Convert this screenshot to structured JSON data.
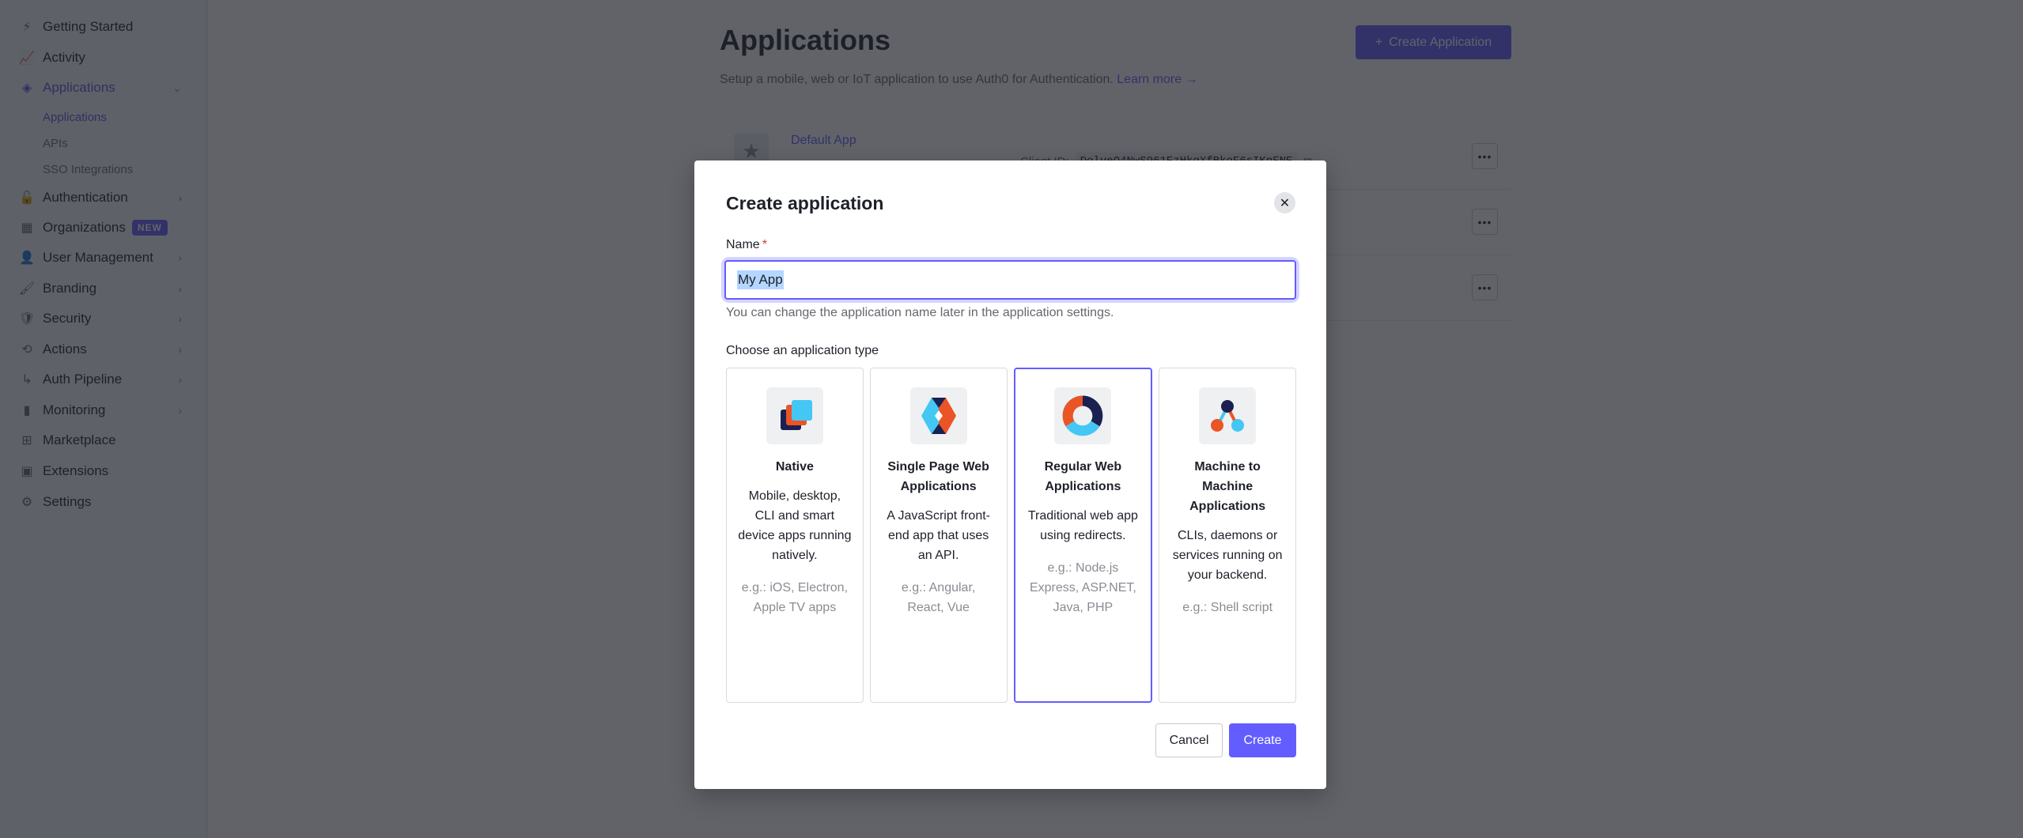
{
  "sidebar": {
    "items": [
      {
        "label": "Getting Started",
        "icon": "lightning-icon"
      },
      {
        "label": "Activity",
        "icon": "activity-icon"
      },
      {
        "label": "Applications",
        "icon": "layers-icon",
        "expanded": true,
        "active": true
      },
      {
        "label": "Authentication",
        "icon": "lock-icon"
      },
      {
        "label": "Organizations",
        "icon": "building-icon",
        "badge": "NEW"
      },
      {
        "label": "User Management",
        "icon": "users-icon"
      },
      {
        "label": "Branding",
        "icon": "brush-icon"
      },
      {
        "label": "Security",
        "icon": "shield-icon"
      },
      {
        "label": "Actions",
        "icon": "actions-icon"
      },
      {
        "label": "Auth Pipeline",
        "icon": "pipeline-icon"
      },
      {
        "label": "Monitoring",
        "icon": "chart-icon"
      },
      {
        "label": "Marketplace",
        "icon": "marketplace-icon"
      },
      {
        "label": "Extensions",
        "icon": "chip-icon"
      },
      {
        "label": "Settings",
        "icon": "gear-icon"
      }
    ],
    "subitems": [
      {
        "label": "Applications",
        "active": true
      },
      {
        "label": "APIs"
      },
      {
        "label": "SSO Integrations"
      }
    ]
  },
  "page": {
    "title": "Applications",
    "description": "Setup a mobile, web or IoT application to use Auth0 for Authentication.",
    "learn_more": "Learn more →",
    "create_button": "Create Application",
    "create_button_icon": "+",
    "apps": [
      {
        "name": "Default App",
        "client_id_label": "Client ID:",
        "client_id": "DolveQ4NwS961EzHkqXfBkoF6sIKnENE"
      }
    ],
    "more_label": "•••"
  },
  "modal": {
    "title": "Create application",
    "close_icon": "✕",
    "name_label": "Name",
    "required_mark": "*",
    "name_value": "My App",
    "name_hint": "You can change the application name later in the application settings.",
    "type_label": "Choose an application type",
    "types": [
      {
        "title": "Native",
        "description": "Mobile, desktop, CLI and smart device apps running natively.",
        "examples": "e.g.: iOS, Electron, Apple TV apps",
        "selected": false
      },
      {
        "title": "Single Page Web Applications",
        "description": "A JavaScript front-end app that uses an API.",
        "examples": "e.g.: Angular, React, Vue",
        "selected": false
      },
      {
        "title": "Regular Web Applications",
        "description": "Traditional web app using redirects.",
        "examples": "e.g.: Node.js Express, ASP.NET, Java, PHP",
        "selected": true
      },
      {
        "title": "Machine to Machine Applications",
        "description": "CLIs, daemons or services running on your backend.",
        "examples": "e.g.: Shell script",
        "selected": false
      }
    ],
    "cancel_label": "Cancel",
    "create_label": "Create"
  },
  "colors": {
    "accent": "#635dff",
    "navy": "#1a2151",
    "orange": "#eb5424",
    "sky": "#44c7f4",
    "required": "#d03c38"
  }
}
